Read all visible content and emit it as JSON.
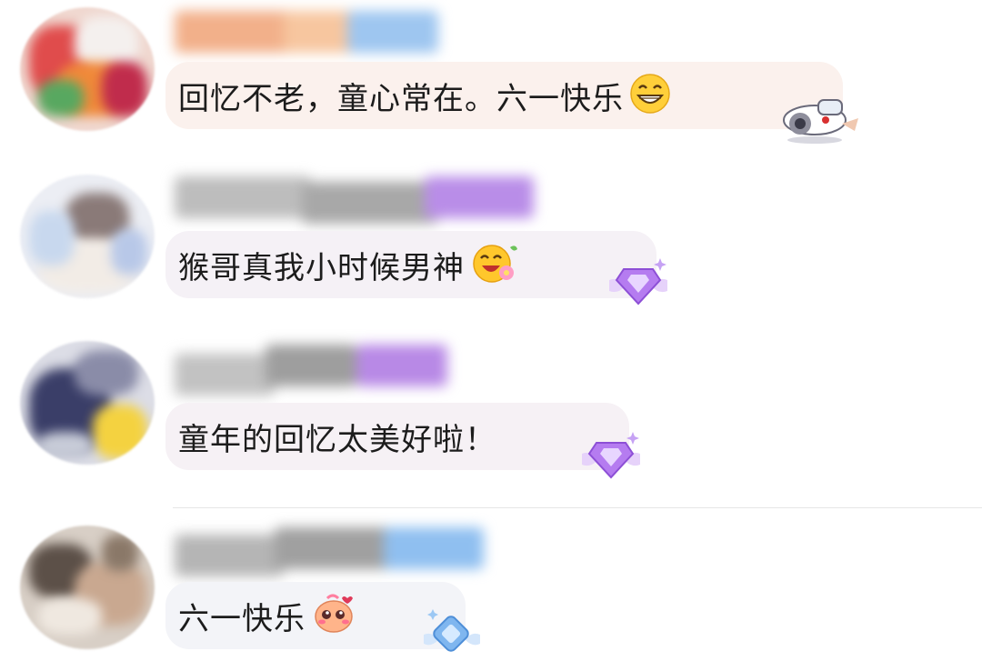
{
  "comments": [
    {
      "author": "",
      "message": "回忆不老，童心常在。六一快乐",
      "emoji_icon": "grinning-face-icon",
      "badge_icon": "airplane-sticker-icon",
      "colors": {
        "bubble": "#fbf1ed",
        "name_blur": [
          "#f2b08a",
          "#f7c69f",
          "#9ec6f0"
        ]
      }
    },
    {
      "author": "",
      "message": "猴哥真我小时候男神",
      "emoji_icon": "happy-flower-face-icon",
      "badge_icon": "purple-diamond-wings-badge-icon",
      "colors": {
        "bubble": "#f5f1f6",
        "name_blur": [
          "#bdbdbd",
          "#a8a8a8",
          "#b98de8"
        ]
      }
    },
    {
      "author": "",
      "message": "童年的回忆太美好啦！",
      "emoji_icon": "",
      "badge_icon": "purple-diamond-wings-badge-icon",
      "colors": {
        "bubble": "#f6f1f5",
        "name_blur": [
          "#c2c2c2",
          "#9e9e9e",
          "#b889e6"
        ]
      }
    },
    {
      "author": "",
      "message": "六一快乐",
      "emoji_icon": "cute-blushing-face-icon",
      "badge_icon": "blue-diamond-wings-badge-icon",
      "colors": {
        "bubble": "#f3f4f8",
        "name_blur": [
          "#b5b5b5",
          "#a0a0a0",
          "#8fbff0"
        ]
      }
    }
  ]
}
